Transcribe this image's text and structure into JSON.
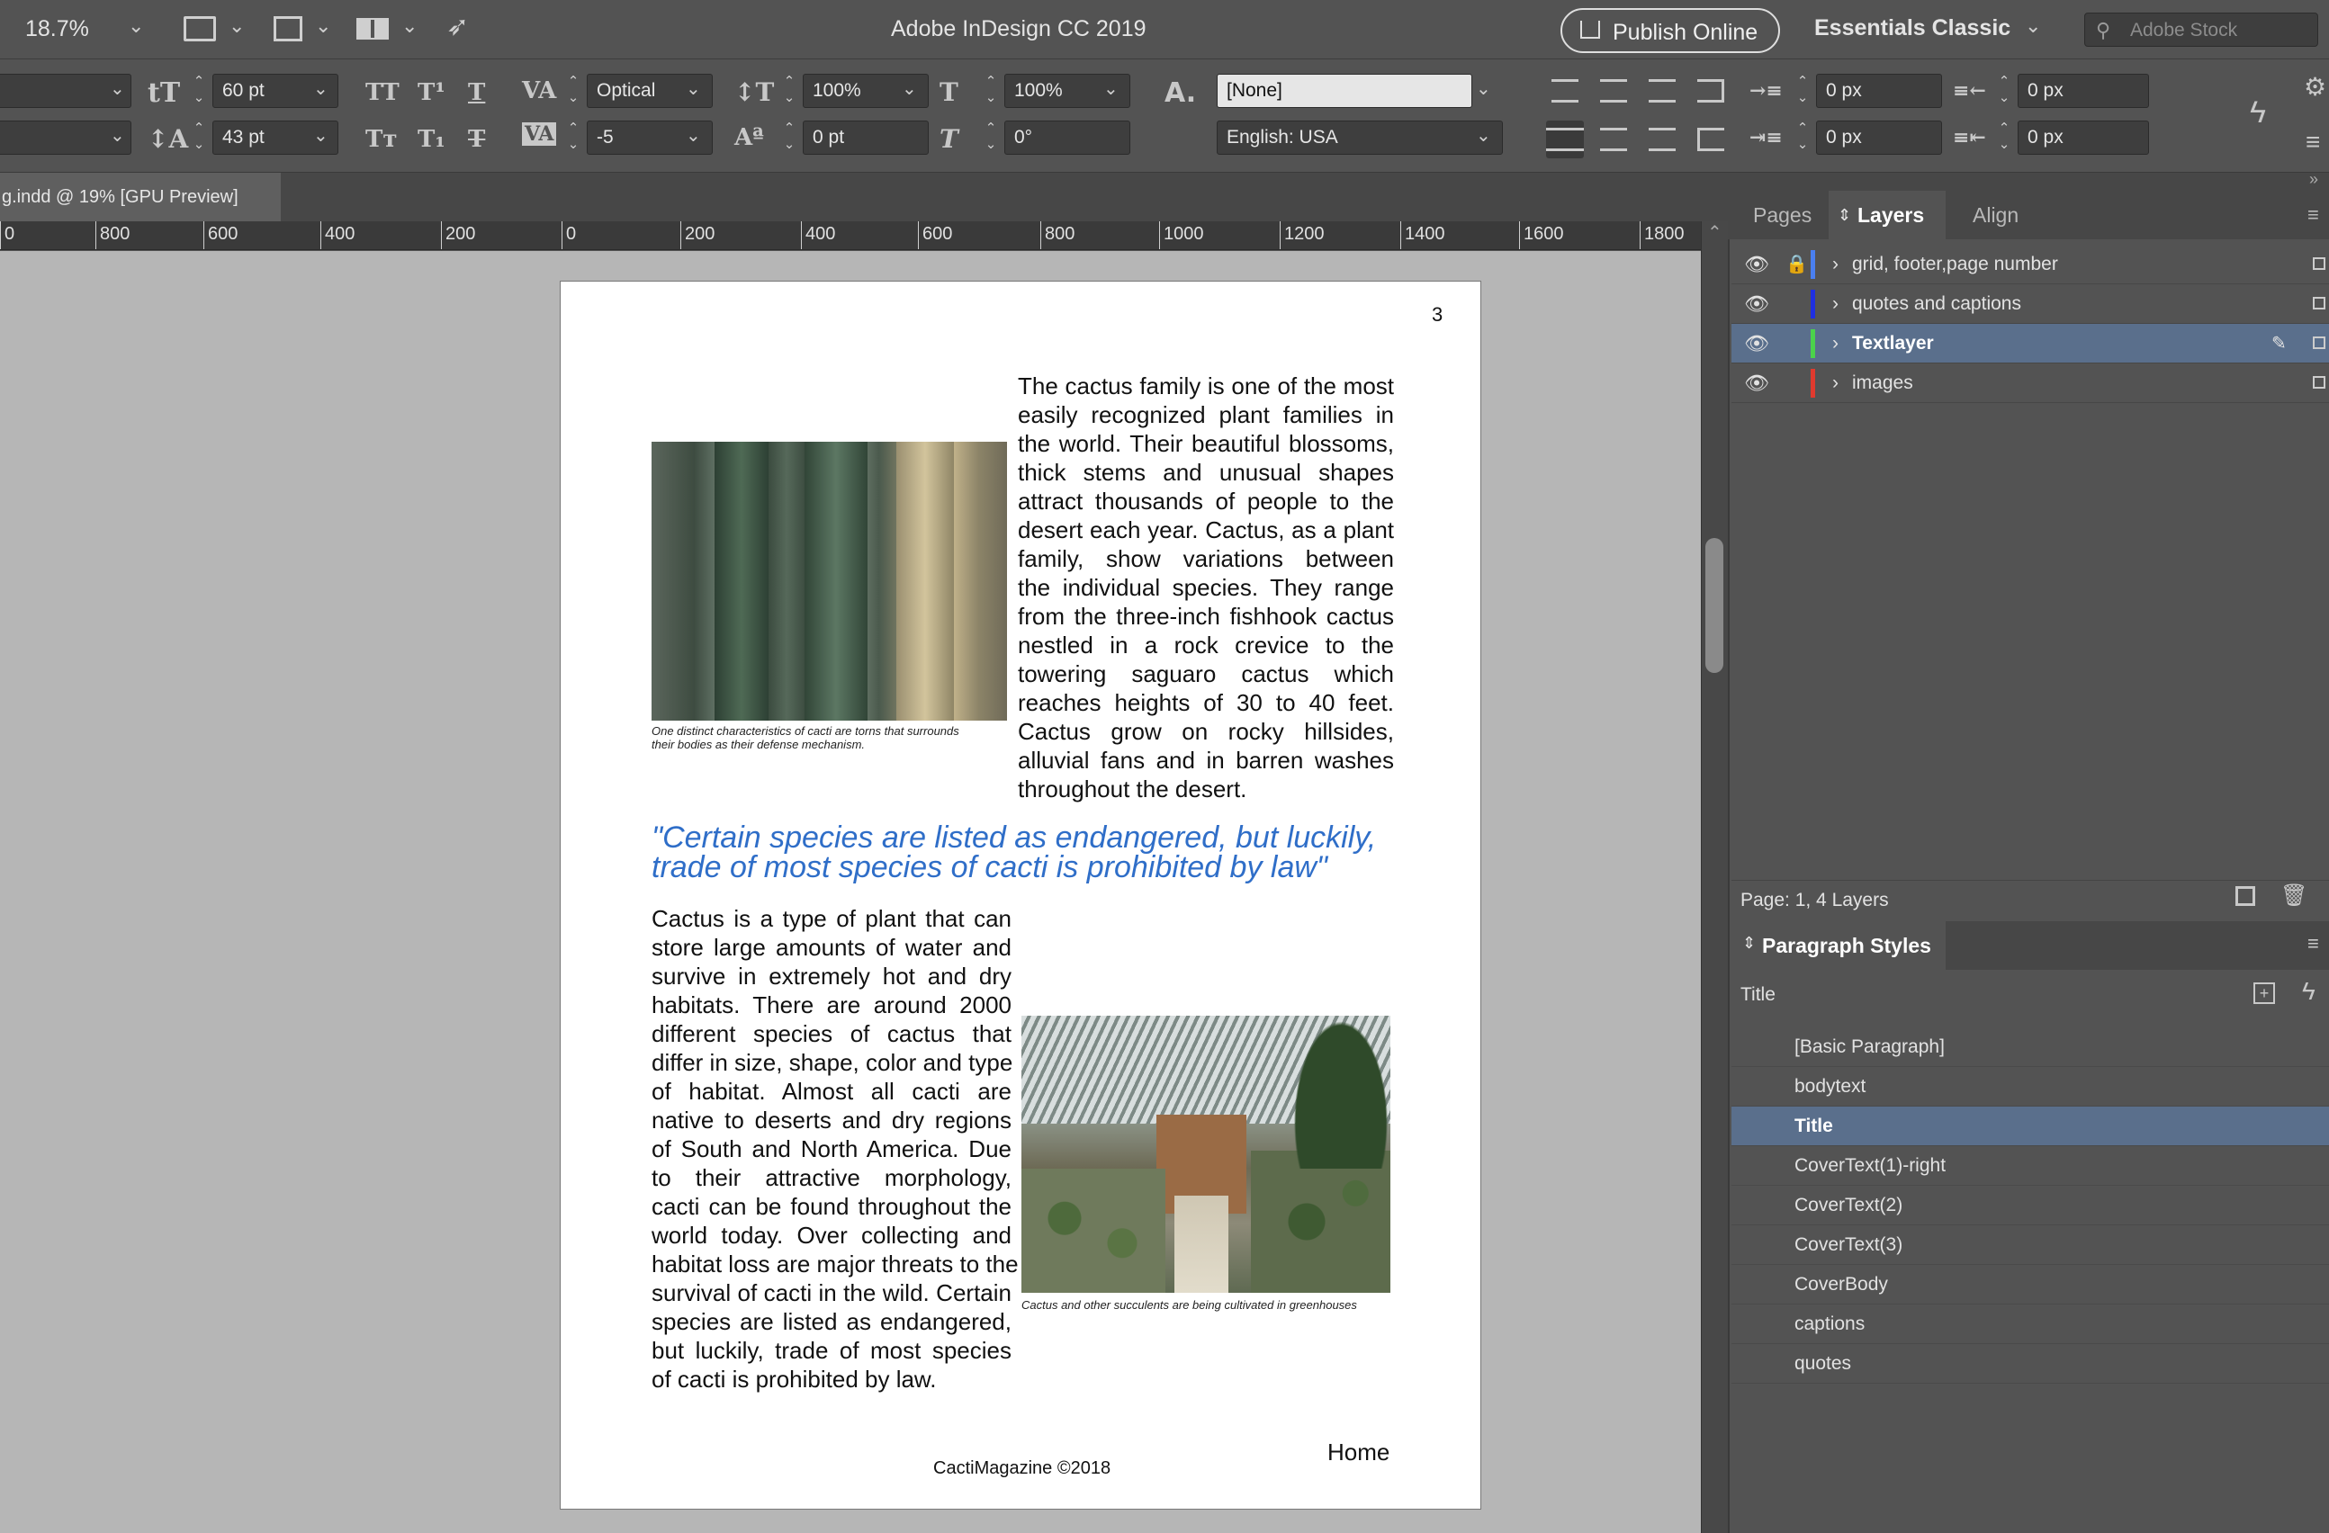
{
  "app": {
    "title": "Adobe InDesign CC 2019",
    "zoom": "18.7%",
    "publish_label": "Publish Online",
    "workspace": "Essentials Classic",
    "search_placeholder": "Adobe Stock"
  },
  "control": {
    "font_size": "60 pt",
    "leading": "43 pt",
    "kerning": "Optical",
    "tracking": "-5",
    "vscale": "100%",
    "hscale": "100%",
    "baseline": "0 pt",
    "skew": "0°",
    "char_style": "[None]",
    "language": "English: USA",
    "indent_left": "0 px",
    "indent_right": "0 px",
    "space_before": "0 px",
    "space_after": "0 px"
  },
  "document": {
    "tab_title": "g.indd @ 19% [GPU Preview]"
  },
  "ruler": {
    "labels": [
      "0",
      "800",
      "600",
      "400",
      "200",
      "0",
      "200",
      "400",
      "600",
      "800",
      "1000",
      "1200",
      "1400",
      "1600",
      "1800"
    ]
  },
  "page": {
    "number": "3",
    "intro_lines": [
      "The cactus family is one of the most",
      "easily recognized plant families in",
      "the world. Their beautiful blossoms,",
      "thick stems and unusual shapes",
      "attract thousands of people to the",
      "desert each year. Cactus, as a plant",
      "family, show variations between",
      "the individual species. They range",
      "from the three-inch fishhook cactus",
      "nestled in a rock crevice to the",
      "towering saguaro cactus which",
      "reaches heights of 30 to 40 feet.",
      "Cactus grow on rocky hillsides,",
      "alluvial fans and in barren washes",
      "throughout the desert."
    ],
    "caption1_lines": [
      "One distinct characteristics of cacti are torns that surrounds",
      "their bodies as their  defense mechanism."
    ],
    "quote_lines": [
      "\"Certain species are listed as endangered, but luckily,",
      "trade of most species of cacti is prohibited by law\""
    ],
    "body2_lines": [
      "Cactus is a type of plant that can",
      "store large amounts of water and",
      "survive in extremely hot and dry",
      "habitats. There are around 2000",
      "different species of cactus that",
      "differ in size, shape, color and type",
      "of habitat. Almost all cacti are",
      "native to deserts and dry regions",
      "of South and North America. Due",
      "to their attractive morphology,",
      "cacti can be found throughout the",
      "world today. Over collecting and",
      "habitat loss are major threats to the",
      "survival of cacti in the wild. Certain",
      "species are listed as endangered,",
      "but luckily, trade of most species",
      "of cacti is prohibited by law."
    ],
    "caption2": "Cactus and other succulents are being cultivated in greenhouses",
    "footer": "CactiMagazine ©2018",
    "home": "Home"
  },
  "panels": {
    "tabs": [
      "Pages",
      "Layers",
      "Align"
    ],
    "layers": [
      {
        "name": "grid, footer,page number",
        "color": "#4a7ff0"
      },
      {
        "name": "quotes and captions",
        "color": "#1f2fe0"
      },
      {
        "name": "Textlayer",
        "color": "#4bd24b"
      },
      {
        "name": "images",
        "color": "#e03a2e"
      }
    ],
    "layers_status": "Page: 1, 4 Layers",
    "para_title": "Paragraph Styles",
    "current_style": "Title",
    "styles": [
      "[Basic Paragraph]",
      "bodytext",
      "Title",
      "CoverText(1)-right",
      "CoverText(2)",
      "CoverText(3)",
      "CoverBody",
      "captions",
      "quotes"
    ]
  }
}
